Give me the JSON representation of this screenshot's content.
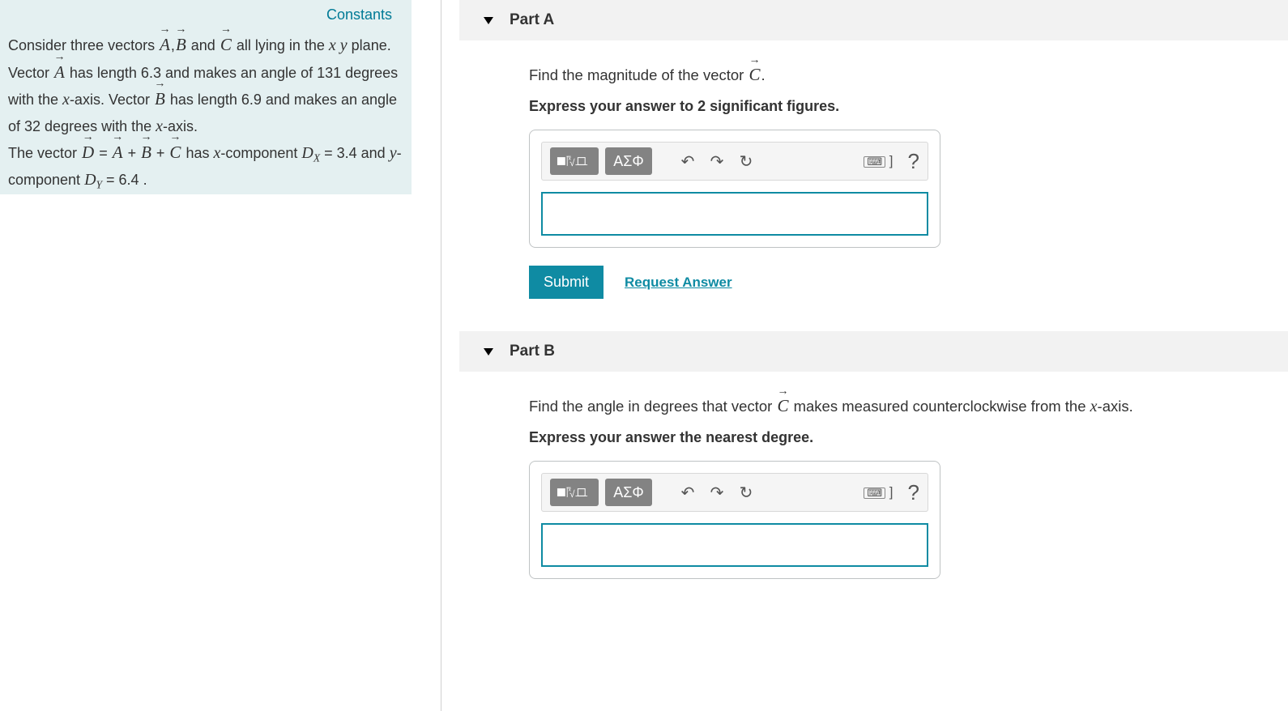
{
  "sidebar": {
    "constants_link": "Constants",
    "problem": {
      "line1a": "Consider three vectors ",
      "vecA": "A",
      "sep1": ",",
      "vecB": "B",
      "and": " and ",
      "vecC": "C",
      "line1b": " all lying in the ",
      "xy": "x y",
      "line2a": " plane. Vector ",
      "line2b": " has length 6.3 and makes an angle of 131 degrees with the ",
      "xaxis": "x",
      "axis": "-axis. Vector ",
      "line3a": " has length 6.9 and makes an angle of 32 degrees with the ",
      "line4a": "The vector ",
      "vecD": "D",
      "eq": " = ",
      "plus": " + ",
      "line4b": " has ",
      "xcomp": "x",
      "comp": "-component ",
      "DX": "D",
      "Xsub": "X",
      "eqval1": " = 3.4 and ",
      "ycomp": "y",
      "DY": "D",
      "Ysub": "Y",
      "eqval2": " = 6.4 ."
    }
  },
  "partA": {
    "title": "Part A",
    "prompt_pre": "Find the magnitude of the vector ",
    "prompt_vec": "C",
    "prompt_post": ".",
    "instructions": "Express your answer to 2 significant figures.",
    "toolbar": {
      "greek": "ΑΣΦ"
    },
    "submit": "Submit",
    "request": "Request Answer"
  },
  "partB": {
    "title": "Part B",
    "prompt_pre": "Find the angle in degrees that vector ",
    "prompt_vec": "C",
    "prompt_post": " makes measured counterclockwise from the ",
    "prompt_x": "x",
    "prompt_axis": "-axis.",
    "instructions": "Express your answer the nearest degree.",
    "toolbar": {
      "greek": "ΑΣΦ"
    }
  }
}
